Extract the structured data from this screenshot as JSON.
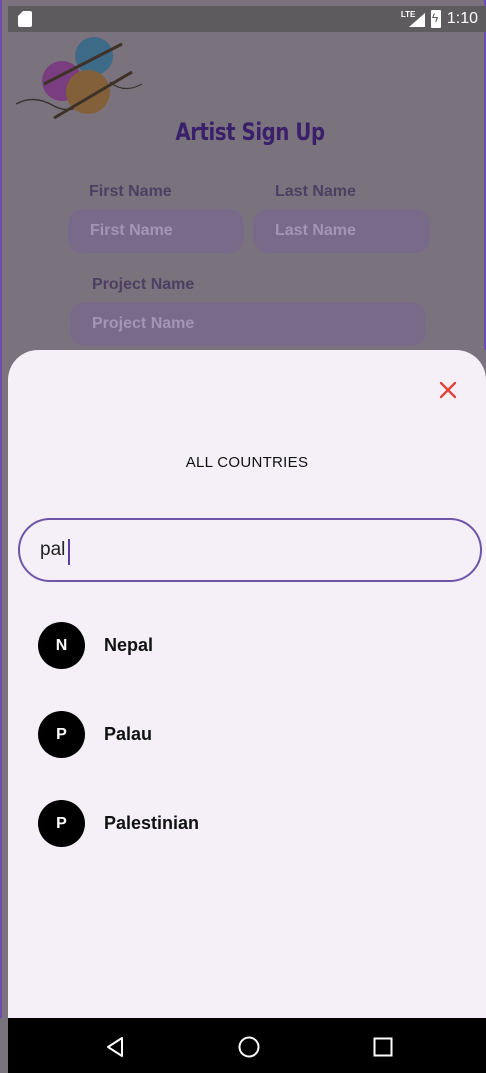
{
  "status_bar": {
    "time": "1:10",
    "network": "LTE",
    "icons": [
      "sd-card-icon",
      "lte-signal-icon",
      "battery-charging-icon"
    ]
  },
  "form": {
    "title": "Artist Sign Up",
    "first_name_label": "First Name",
    "first_name_placeholder": "First Name",
    "last_name_label": "Last Name",
    "last_name_placeholder": "Last Name",
    "project_name_label": "Project Name",
    "project_name_placeholder": "Project Name"
  },
  "sheet": {
    "title": "ALL COUNTRIES",
    "search_value": "pal",
    "close_icon": "close-icon",
    "accent_color": "#6d55a8",
    "close_color": "#e0463f",
    "countries": [
      {
        "initial": "N",
        "name": "Nepal"
      },
      {
        "initial": "P",
        "name": "Palau"
      },
      {
        "initial": "P",
        "name": "Palestinian"
      }
    ]
  },
  "nav_bar": {
    "icons": [
      "back-icon",
      "home-icon",
      "recents-icon"
    ]
  }
}
